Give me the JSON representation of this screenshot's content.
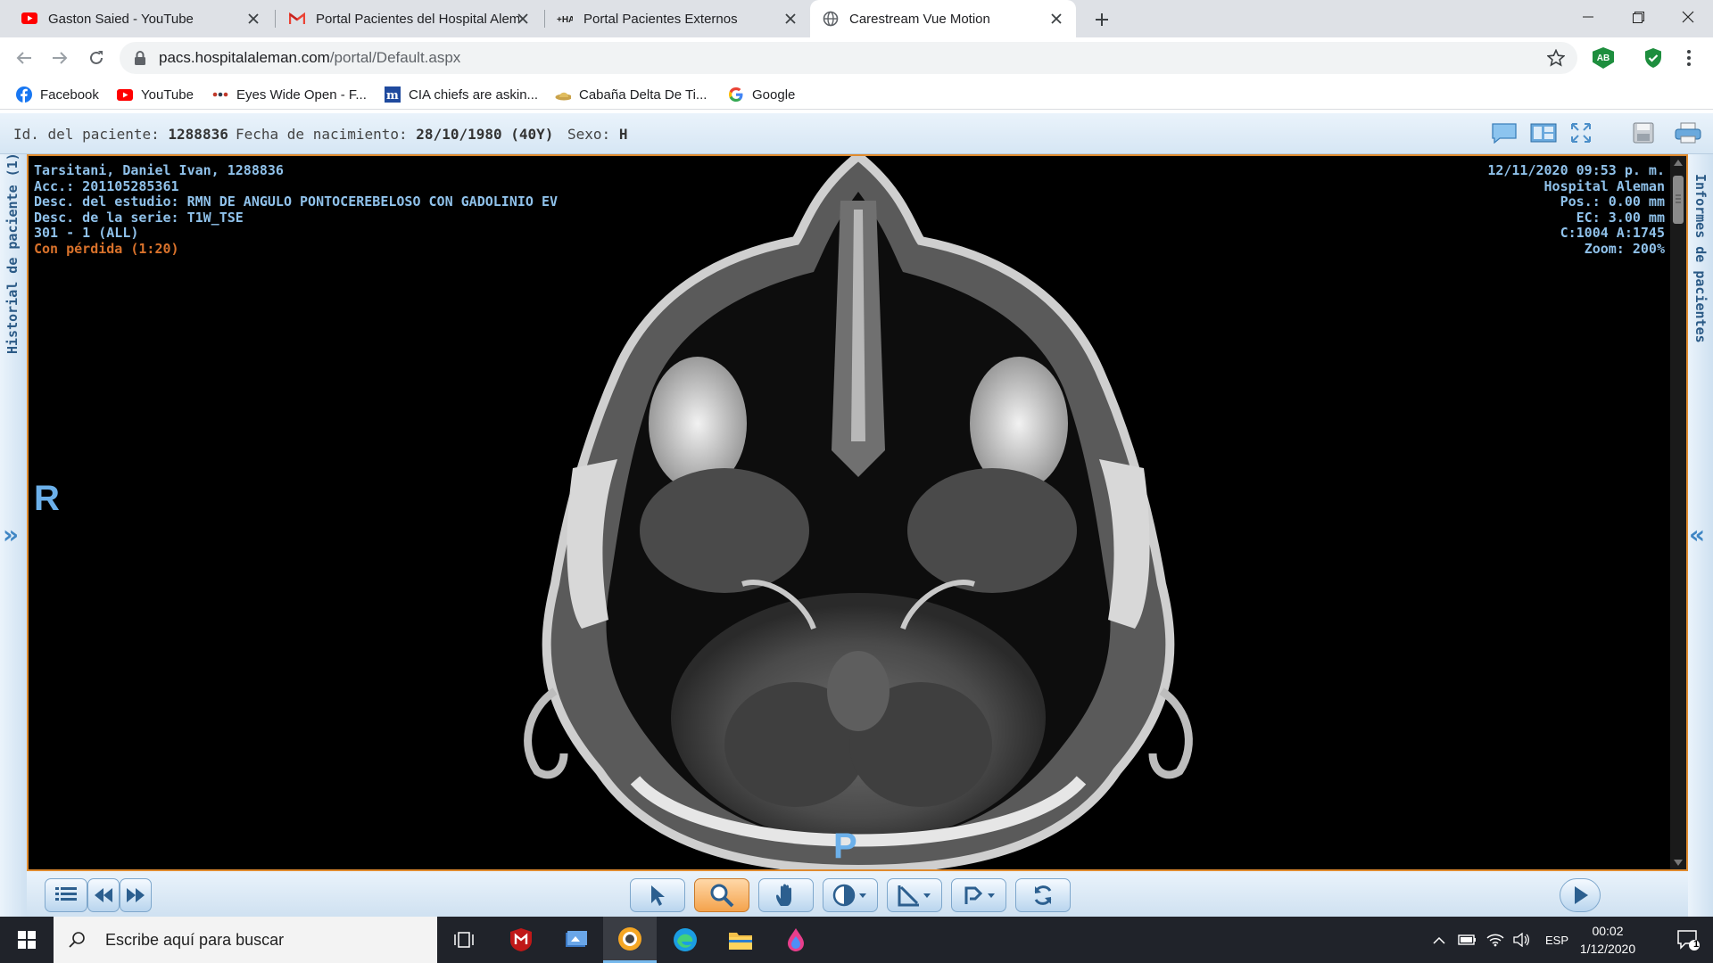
{
  "browser": {
    "tabs": [
      {
        "title": "Gaston Saied - YouTube",
        "icon": "youtube-icon"
      },
      {
        "title": "Portal Pacientes del Hospital Alem",
        "icon": "gmail-icon"
      },
      {
        "title": "Portal Pacientes Externos",
        "icon": "ha-logo-icon"
      },
      {
        "title": "Carestream Vue Motion",
        "icon": "globe-icon",
        "active": true
      }
    ],
    "url": {
      "domain": "pacs.hospitalaleman.com",
      "path": "/portal/Default.aspx"
    },
    "extensions": [
      {
        "name": "adblock-icon",
        "label": "AB",
        "color": "#1e8e3e"
      },
      {
        "name": "shield-check-icon",
        "color": "#1e8e3e"
      }
    ],
    "bookmarks": [
      {
        "label": "Facebook",
        "icon": "facebook-icon"
      },
      {
        "label": "YouTube",
        "icon": "youtube-icon"
      },
      {
        "label": "Eyes Wide Open - F...",
        "icon": "dots-icon"
      },
      {
        "label": "CIA chiefs are askin...",
        "icon": "m-logo-icon"
      },
      {
        "label": "Cabaña Delta De Ti...",
        "icon": "hat-icon"
      },
      {
        "label": "Google",
        "icon": "google-icon"
      }
    ]
  },
  "patient": {
    "id_label": "Id. del paciente:",
    "id_value": "1288836",
    "dob_label": "Fecha de nacimiento:",
    "dob_value": "28/10/1980 (40Y)",
    "sex_label": "Sexo:",
    "sex_value": "H"
  },
  "side": {
    "left_label": "Historial de paciente (1)",
    "right_label": "Informes de pacientes",
    "left_chevron": "»",
    "right_chevron": "«"
  },
  "overlay": {
    "left": [
      "Tarsitani, Daniel Ivan, 1288836",
      "Acc.: 201105285361",
      "Desc. del estudio: RMN DE ANGULO PONTOCEREBELOSO CON GADOLINIO EV",
      "Desc. de la serie: T1W_TSE",
      "301 - 1 (ALL)"
    ],
    "compression": "Con pérdida (1:20)",
    "right": [
      "12/11/2020 09:53 p. m.",
      "Hospital Aleman",
      "Pos.: 0.00 mm",
      "EC: 3.00 mm",
      "C:1004 A:1745",
      "Zoom: 200%"
    ],
    "orient_left": "R",
    "orient_bottom": "P"
  },
  "colors": {
    "accent": "#e08b2e",
    "overlay_text": "#8fc1ea",
    "orientation": "#6cb0ea",
    "header_bg": "#d6e6f4"
  },
  "taskbar": {
    "search_placeholder": "Escribe aquí para buscar",
    "lang": "ESP",
    "time": "00:02",
    "date": "1/12/2020",
    "notification_count": "1"
  }
}
